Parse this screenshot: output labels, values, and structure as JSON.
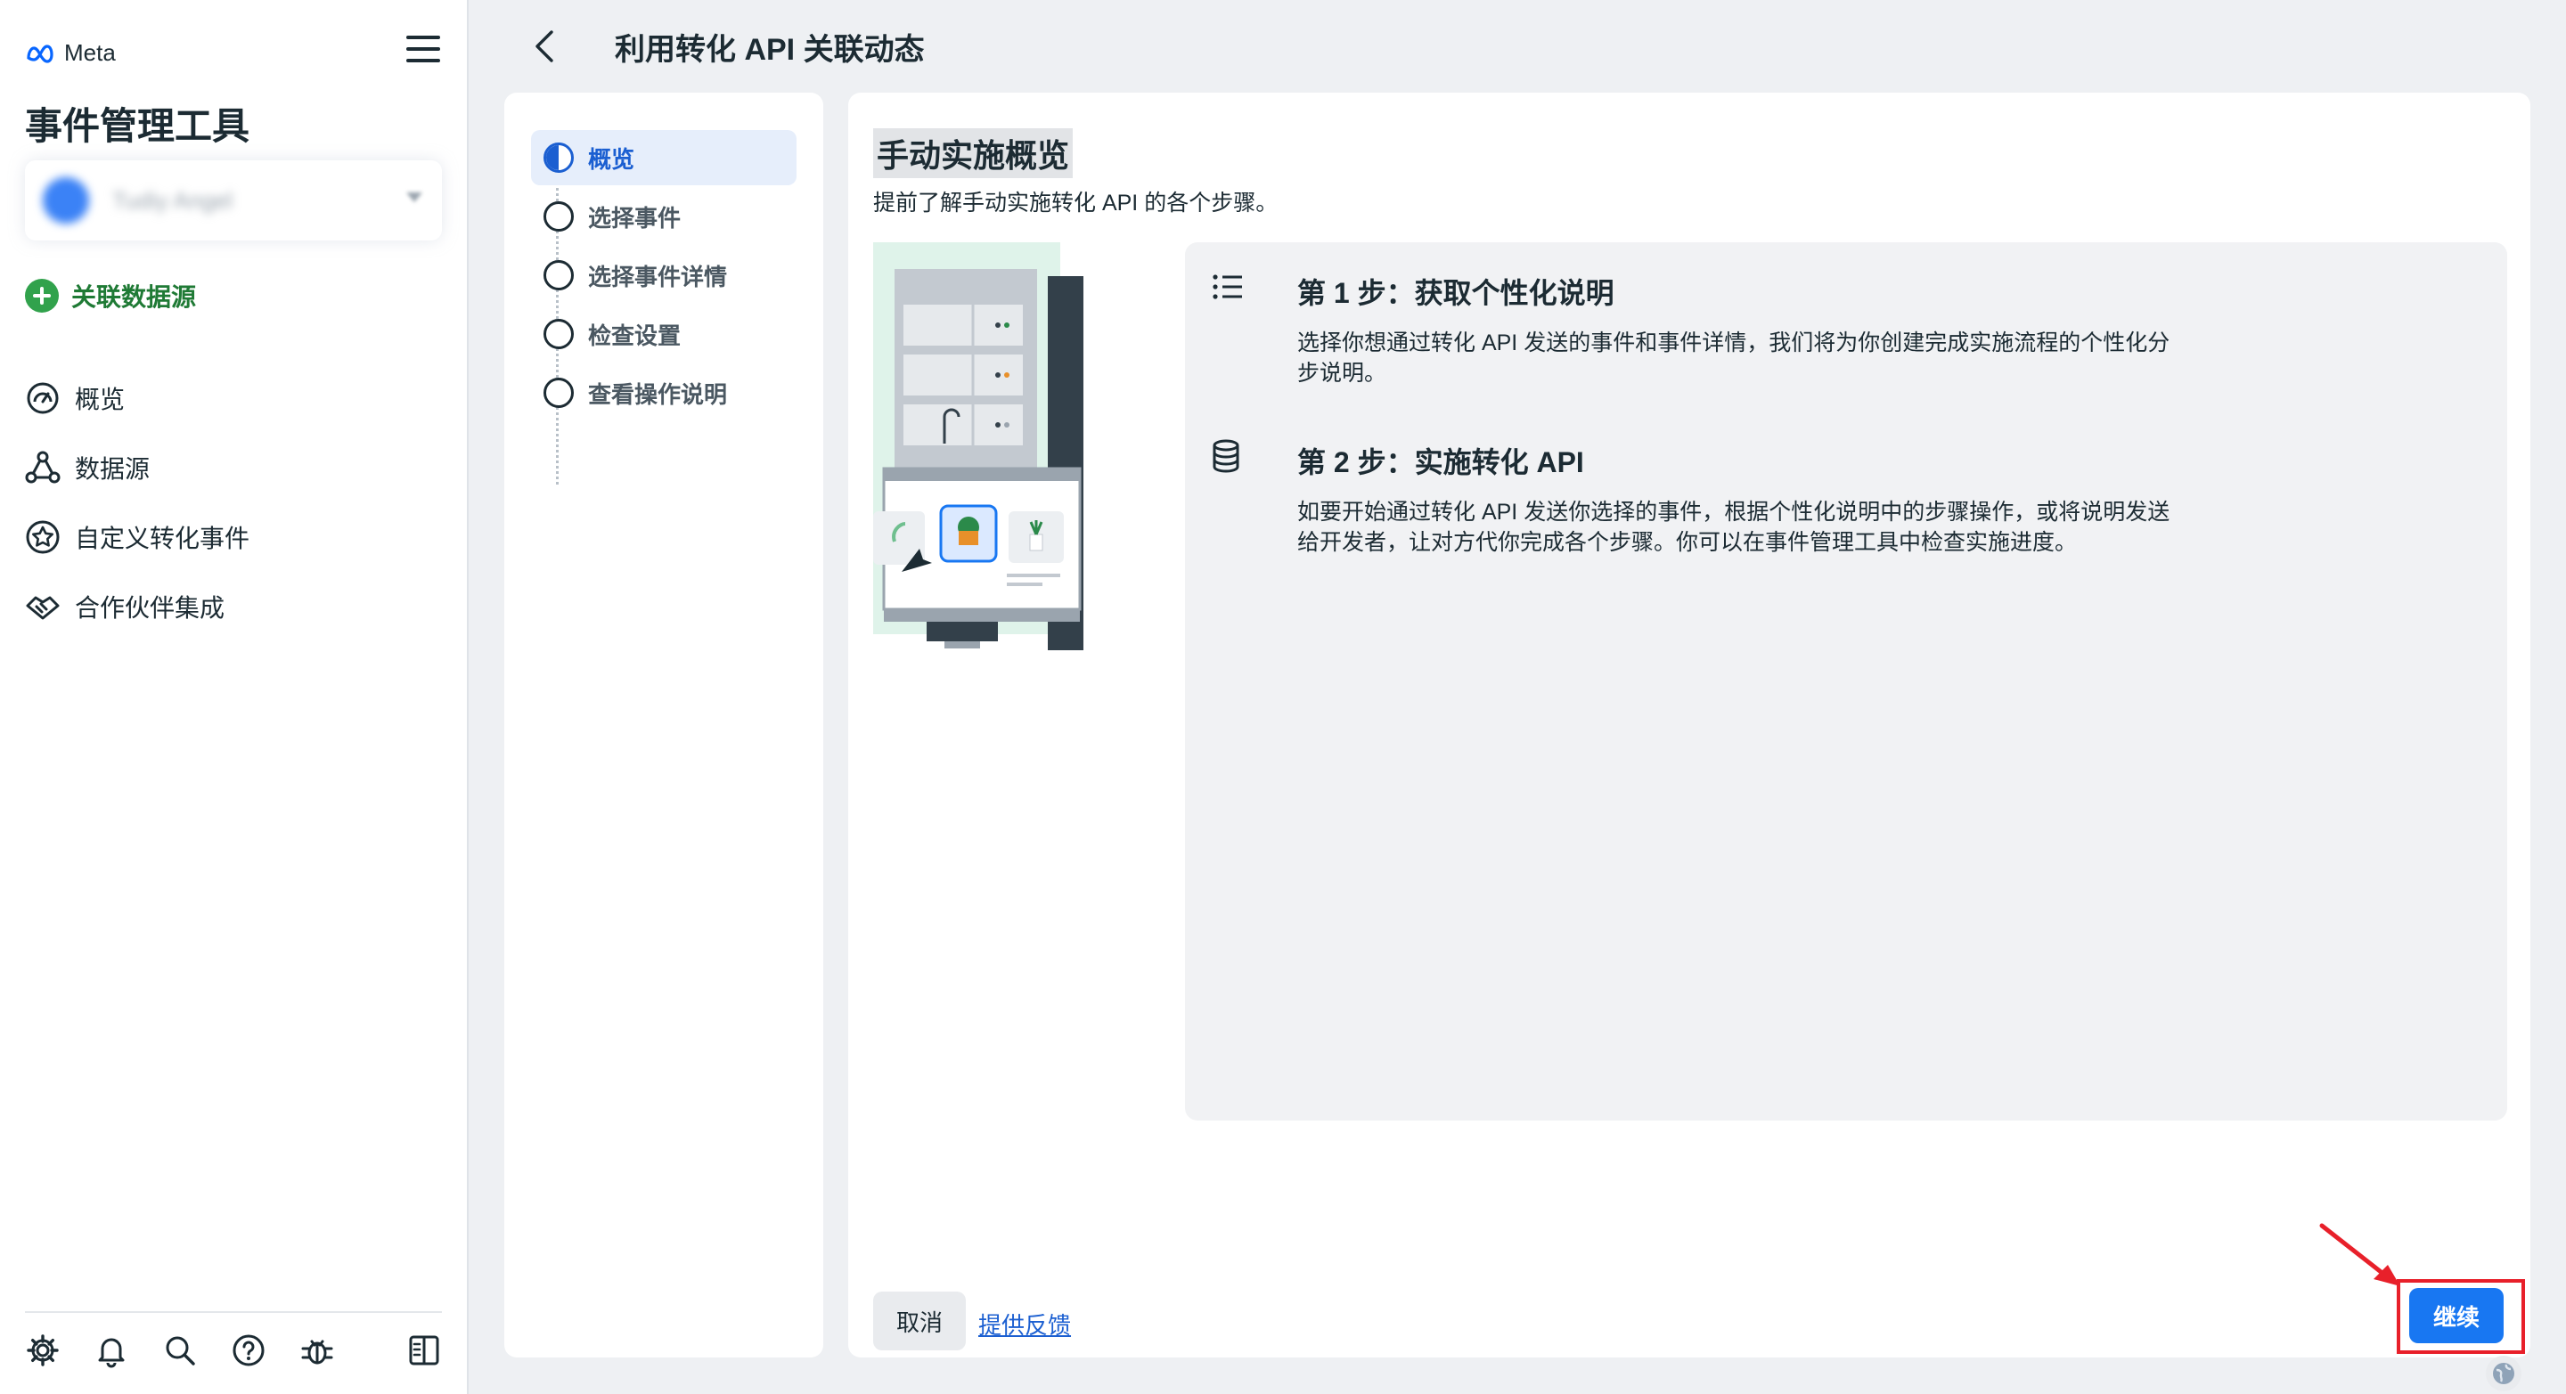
{
  "brand": {
    "name": "Meta",
    "icon": "meta-infinity-logo"
  },
  "app": {
    "title": "事件管理工具"
  },
  "account": {
    "name": "Tudiy Angel"
  },
  "sidebar": {
    "connect_label": "关联数据源",
    "nav": [
      {
        "label": "概览",
        "icon": "dashboard-gauge-icon"
      },
      {
        "label": "数据源",
        "icon": "data-sources-icon"
      },
      {
        "label": "自定义转化事件",
        "icon": "star-badge-icon"
      },
      {
        "label": "合作伙伴集成",
        "icon": "handshake-icon"
      }
    ],
    "footer_icons": [
      "gear-icon",
      "bell-icon",
      "search-icon",
      "help-icon",
      "bug-icon",
      "panel-toggle-icon"
    ]
  },
  "header": {
    "title": "利用转化 API 关联动态"
  },
  "steps": [
    {
      "label": "概览",
      "active": true
    },
    {
      "label": "选择事件",
      "active": false
    },
    {
      "label": "选择事件详情",
      "active": false
    },
    {
      "label": "检查设置",
      "active": false
    },
    {
      "label": "查看操作说明",
      "active": false
    }
  ],
  "main": {
    "title": "手动实施概览",
    "subtitle": "提前了解手动实施转化 API 的各个步骤。",
    "instructions": [
      {
        "icon": "list-icon",
        "title": "第 1 步：获取个性化说明",
        "body": "选择你想通过转化 API 发送的事件和事件详情，我们将为你创建完成实施流程的个性化分步说明。"
      },
      {
        "icon": "database-icon",
        "title": "第 2 步：实施转化 API",
        "body": "如要开始通过转化 API 发送你选择的事件，根据个性化说明中的步骤操作，或将说明发送给开发者，让对方代你完成各个步骤。你可以在事件管理工具中检查实施进度。"
      }
    ],
    "cancel_label": "取消",
    "feedback_label": "提供反馈",
    "continue_label": "继续"
  },
  "colors": {
    "accent": "#1877f2",
    "active_step": "#1b5fd1",
    "success": "#31a24c",
    "highlight": "#e8202a"
  }
}
